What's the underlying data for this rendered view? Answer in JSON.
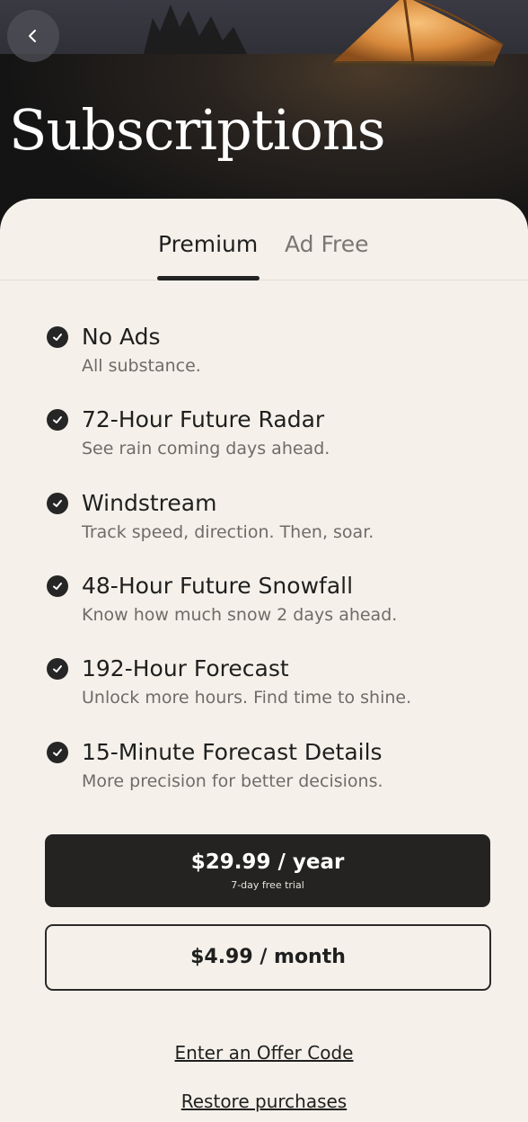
{
  "header": {
    "title": "Subscriptions",
    "back_icon": "chevron-left-icon"
  },
  "tabs": [
    {
      "label": "Premium",
      "active": true
    },
    {
      "label": "Ad Free",
      "active": false
    }
  ],
  "features": [
    {
      "title": "No Ads",
      "description": "All substance."
    },
    {
      "title": "72-Hour Future Radar",
      "description": "See rain coming days ahead."
    },
    {
      "title": "Windstream",
      "description": "Track speed, direction. Then, soar."
    },
    {
      "title": "48-Hour Future Snowfall",
      "description": "Know how much snow 2 days ahead."
    },
    {
      "title": "192-Hour Forecast",
      "description": "Unlock more hours. Find time to shine."
    },
    {
      "title": "15-Minute Forecast Details",
      "description": "More precision for better decisions."
    }
  ],
  "plans": {
    "yearly": {
      "price": "$29.99 / year",
      "trial": "7-day free trial"
    },
    "monthly": {
      "price": "$4.99 / month"
    }
  },
  "links": {
    "offer_code": "Enter an Offer Code",
    "restore": "Restore purchases"
  },
  "colors": {
    "background": "#f5f1ea",
    "primary_button": "#242322",
    "text": "#1f1f1f",
    "muted_text": "#6f6b66"
  }
}
